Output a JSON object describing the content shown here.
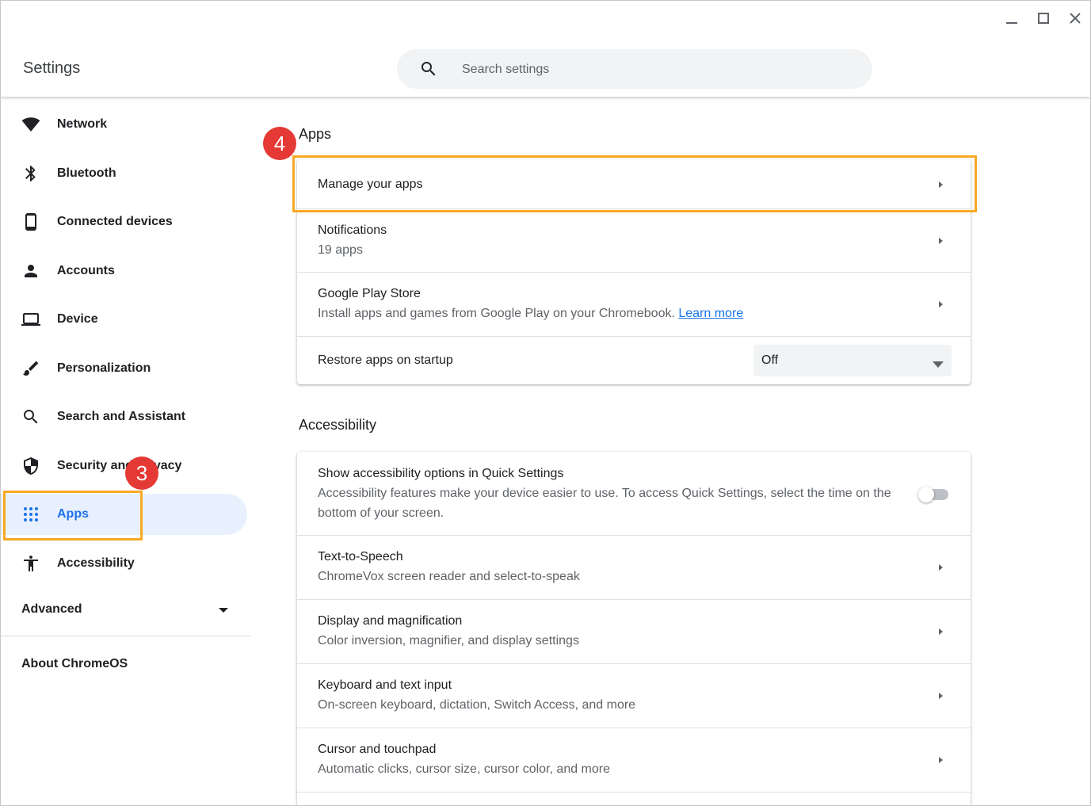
{
  "header": {
    "app_title": "Settings",
    "search_placeholder": "Search settings",
    "window_controls": [
      "minimize-icon",
      "maximize-icon",
      "close-icon"
    ]
  },
  "sidebar": {
    "items": [
      {
        "label": "Network",
        "icon": "wifi-icon"
      },
      {
        "label": "Bluetooth",
        "icon": "bluetooth-icon"
      },
      {
        "label": "Connected devices",
        "icon": "phone-icon"
      },
      {
        "label": "Accounts",
        "icon": "person-icon"
      },
      {
        "label": "Device",
        "icon": "laptop-icon"
      },
      {
        "label": "Personalization",
        "icon": "brush-icon"
      },
      {
        "label": "Search and Assistant",
        "icon": "search-icon"
      },
      {
        "label": "Security and Privacy",
        "icon": "shield-icon"
      },
      {
        "label": "Apps",
        "icon": "apps-grid-icon",
        "active": true
      },
      {
        "label": "Accessibility",
        "icon": "accessibility-icon"
      }
    ],
    "advanced_label": "Advanced",
    "about_label": "About ChromeOS"
  },
  "apps_section": {
    "title": "Apps",
    "manage_apps": "Manage your apps",
    "notifications": {
      "title": "Notifications",
      "subtitle": "19 apps"
    },
    "play_store": {
      "title": "Google Play Store",
      "subtitle": "Install apps and games from Google Play on your Chromebook.",
      "link": "Learn more"
    },
    "restore": {
      "title": "Restore apps on startup",
      "value": "Off"
    }
  },
  "accessibility_section": {
    "title": "Accessibility",
    "quick_settings": {
      "title": "Show accessibility options in Quick Settings",
      "subtitle_line1": "Accessibility features make your device easier to use. To access Quick Settings, select the time on the",
      "subtitle_line2": "bottom of your screen.",
      "enabled": false
    },
    "tts": {
      "title": "Text-to-Speech",
      "subtitle": "ChromeVox screen reader and select-to-speak"
    },
    "display": {
      "title": "Display and magnification",
      "subtitle": "Color inversion, magnifier, and display settings"
    },
    "keyboard": {
      "title": "Keyboard and text input",
      "subtitle": "On-screen keyboard, dictation, Switch Access, and more"
    },
    "cursor": {
      "title": "Cursor and touchpad",
      "subtitle": "Automatic clicks, cursor size, cursor color, and more"
    }
  },
  "annotations": {
    "step3": "3",
    "step4": "4",
    "highlight_color": "#f9a825",
    "badge_color": "#e53935"
  },
  "colors": {
    "accent": "#1a73e8",
    "active_bg": "#e8f0fe"
  }
}
